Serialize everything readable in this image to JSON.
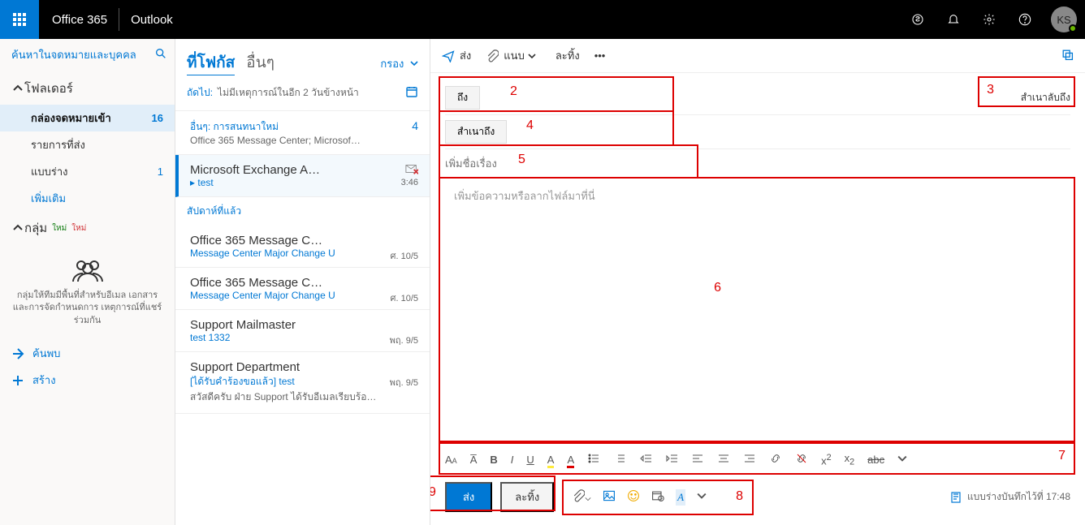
{
  "header": {
    "brand": "Office 365",
    "app": "Outlook",
    "avatar_initials": "KS"
  },
  "nav": {
    "search_placeholder": "ค้นหาในจดหมายและบุคคล",
    "folders_label": "โฟลเดอร์",
    "groups_label": "กลุ่ม",
    "new_badge": "ใหม่",
    "items": [
      {
        "label": "กล่องจดหมายเข้า",
        "count": "16"
      },
      {
        "label": "รายการที่ส่ง",
        "count": ""
      },
      {
        "label": "แบบร่าง",
        "count": "1"
      },
      {
        "label": "เพิ่มเติม",
        "count": ""
      }
    ],
    "group_desc": "กลุ่มให้ทีมมีพื้นที่สำหรับอีเมล เอกสาร และการจัดกำหนดการ เหตุการณ์ที่แชร์ร่วมกัน",
    "discover": "ค้นพบ",
    "create": "สร้าง"
  },
  "listpane": {
    "tab_focused": "ที่โฟกัส",
    "tab_other": "อื่นๆ",
    "filter": "กรอง",
    "agenda_label": "ถัดไป:",
    "agenda_text": "ไม่มีเหตุการณ์ในอีก 2 วันข้างหน้า",
    "section_other": "อื่นๆ: การสนทนาใหม่",
    "section_other_sub": "Office 365 Message Center; Microsof…",
    "section_other_badge": "4",
    "section_lastweek": "สัปดาห์ที่แล้ว",
    "messages": [
      {
        "title": "Microsoft Exchange A…",
        "sub": "▸ test",
        "sub_blue": true,
        "time": "3:46",
        "dismiss": true
      },
      {
        "title": "Office 365 Message C…",
        "sub": "Message Center Major Change U",
        "sub_blue": true,
        "time": "ศ. 10/5"
      },
      {
        "title": "Office 365 Message C…",
        "sub": "Message Center Major Change U",
        "sub_blue": true,
        "time": "ศ. 10/5"
      },
      {
        "title": "Support Mailmaster",
        "sub": "test 1332",
        "sub_blue": true,
        "time": "พฤ. 9/5"
      },
      {
        "title": "Support Department",
        "sub": "[ได้รับคำร้องขอแล้ว] test",
        "sub_blue": true,
        "time": "พฤ. 9/5",
        "preview": "สวัสดีครับ  ฝ่าย Support ได้รับอีเมลเรียบร้อ…"
      }
    ]
  },
  "compose": {
    "cmd_send": "ส่ง",
    "cmd_attach": "แนบ",
    "cmd_discard": "ละทิ้ง",
    "to_btn": "ถึง",
    "cc_btn": "สำเนาถึง",
    "bcc_label": "สำเนาลับถึง",
    "subject_placeholder": "เพิ่มชื่อเรื่อง",
    "body_placeholder": "เพิ่มข้อความหรือลากไฟล์มาที่นี่",
    "send_btn": "ส่ง",
    "discard_btn": "ละทิ้ง",
    "draft_saved": "แบบร่างบันทึกไว้ที่ 17:48"
  },
  "annotations": {
    "n2": "2",
    "n3": "3",
    "n4": "4",
    "n5": "5",
    "n6": "6",
    "n7": "7",
    "n8": "8",
    "n9": "9"
  }
}
